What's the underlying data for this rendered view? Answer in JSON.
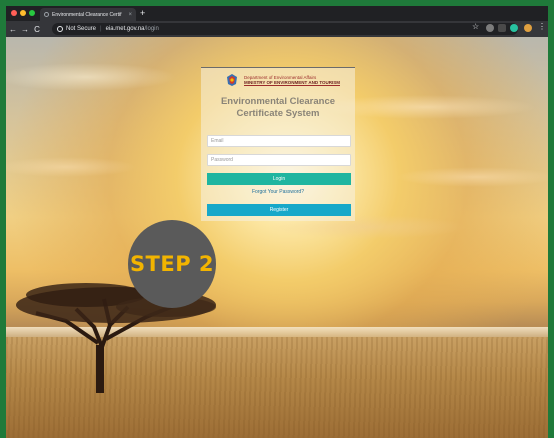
{
  "browser": {
    "tab_title": "Environmental Clearance Certif",
    "tab_close": "×",
    "new_tab": "+",
    "back": "←",
    "forward": "→",
    "reload": "C",
    "security_label": "Not Secure",
    "separator": "|",
    "url_host": "eia.met.gov.na",
    "url_path": "/login",
    "bookmark_star": "☆",
    "menu": "⋮"
  },
  "page": {
    "department": "Department of Environmental Affairs",
    "ministry": "MINISTRY OF ENVIRONMENT AND TOURISM",
    "title_line1": "Environmental Clearance",
    "title_line2": "Certificate System",
    "email_placeholder": "Email",
    "password_placeholder": "Password",
    "login_label": "Login",
    "forgot_label": "Forgot Your Password?",
    "register_label": "Register"
  },
  "overlay": {
    "step_label": "STEP 2"
  },
  "colors": {
    "frame_green": "#1f7a3a",
    "login_button": "#1fb5a0",
    "register_button": "#17a8c9",
    "step_text": "#f2b400",
    "step_circle": "#5a5a5a"
  }
}
